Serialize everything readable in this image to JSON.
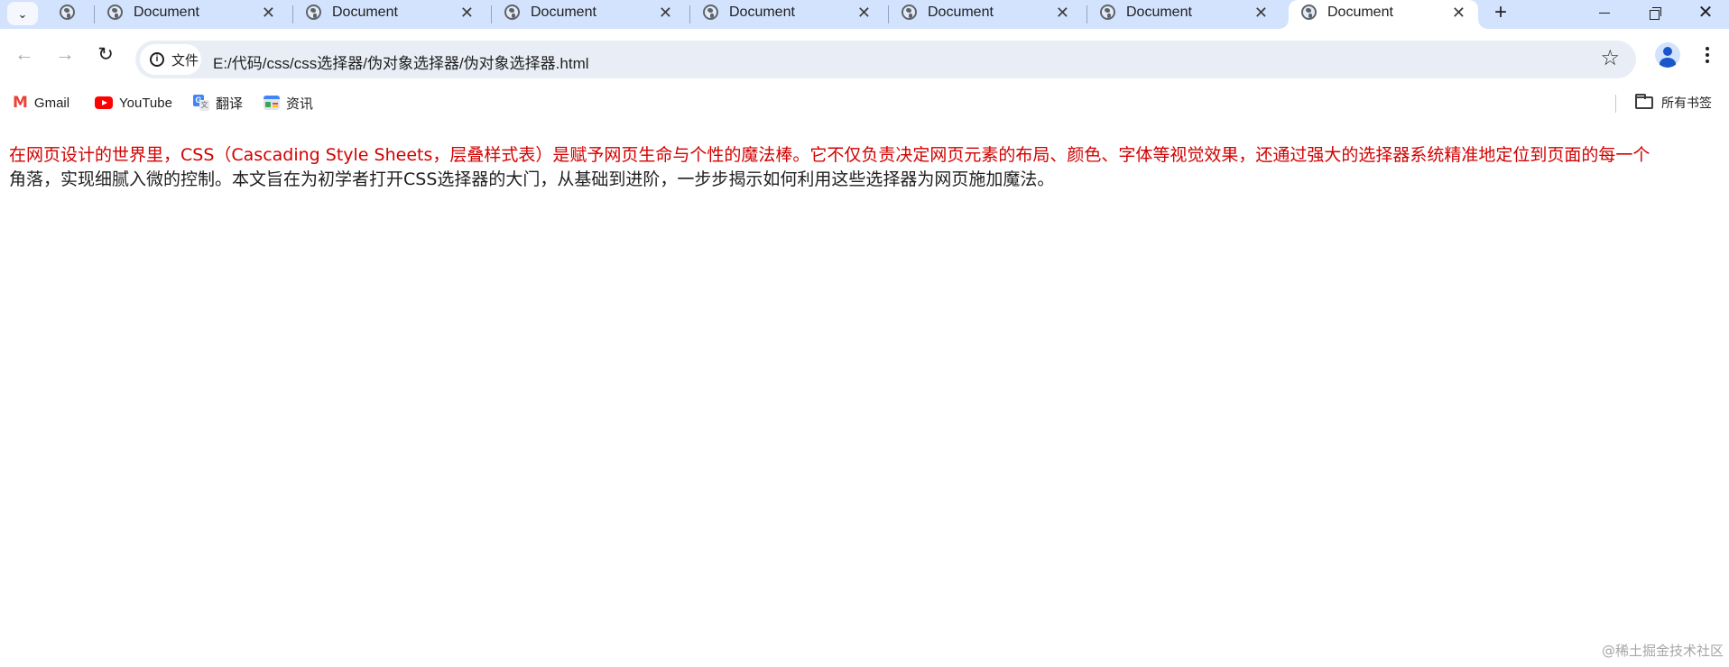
{
  "browser": {
    "tabs": [
      {
        "title": "Document",
        "active": false
      },
      {
        "title": "Document",
        "active": false
      },
      {
        "title": "Document",
        "active": false
      },
      {
        "title": "Document",
        "active": false
      },
      {
        "title": "Document",
        "active": false
      },
      {
        "title": "Document",
        "active": false
      },
      {
        "title": "Document",
        "active": true
      }
    ],
    "new_tab_label": "+",
    "site_chip_label": "文件",
    "url": "E:/代码/css/css选择器/伪对象选择器/伪对象选择器.html",
    "accent_color": "#d3e3fd"
  },
  "bookmarks": {
    "items": [
      {
        "label": "Gmail",
        "icon": "gmail-icon"
      },
      {
        "label": "YouTube",
        "icon": "youtube-icon"
      },
      {
        "label": "翻译",
        "icon": "translate-icon"
      },
      {
        "label": "资讯",
        "icon": "news-icon"
      }
    ],
    "all_bookmarks_label": "所有书签"
  },
  "page": {
    "paragraph_first_line": "在网页设计的世界里，CSS（Cascading Style Sheets，层叠样式表）是赋予网页生命与个性的魔法棒。它不仅负责决定网页元素的布局、颜色、字体等视觉效果，还通过强大的选择器系统精准地定位到页面的每一个",
    "paragraph_rest": "角落，实现细腻入微的控制。本文旨在为初学者打开CSS选择器的大门，从基础到进阶，一步步揭示如何利用这些选择器为网页施加魔法。",
    "first_line_color": "#d20000",
    "watermark": "@稀土掘金技术社区"
  }
}
